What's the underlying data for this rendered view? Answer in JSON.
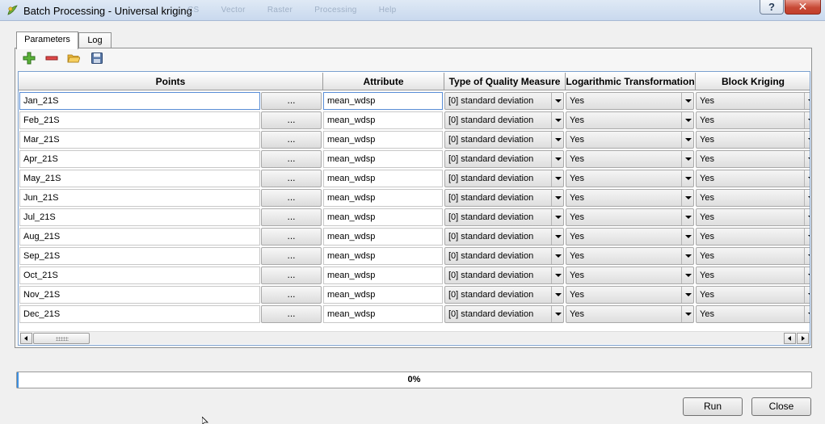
{
  "window": {
    "title": "Batch Processing - Universal kriging",
    "background_menu": [
      "CS",
      "Vector",
      "Raster",
      "Processing",
      "Help"
    ],
    "help_label": "?",
    "close_label": "✕"
  },
  "tabs": [
    {
      "label": "Parameters",
      "active": true
    },
    {
      "label": "Log",
      "active": false
    }
  ],
  "toolbar": {
    "icons": [
      "add-row-icon",
      "remove-row-icon",
      "open-folder-icon",
      "save-icon"
    ]
  },
  "table": {
    "columns": [
      "Points",
      "Attribute",
      "Type of Quality Measure",
      "Logarithmic Transformation",
      "Block Kriging"
    ],
    "browse_label": "...",
    "rows": [
      {
        "points": "Jan_21S",
        "attribute": "mean_wdsp",
        "quality_measure": "[0] standard deviation",
        "log_transform": "Yes",
        "block_kriging": "Yes"
      },
      {
        "points": "Feb_21S",
        "attribute": "mean_wdsp",
        "quality_measure": "[0] standard deviation",
        "log_transform": "Yes",
        "block_kriging": "Yes"
      },
      {
        "points": "Mar_21S",
        "attribute": "mean_wdsp",
        "quality_measure": "[0] standard deviation",
        "log_transform": "Yes",
        "block_kriging": "Yes"
      },
      {
        "points": "Apr_21S",
        "attribute": "mean_wdsp",
        "quality_measure": "[0] standard deviation",
        "log_transform": "Yes",
        "block_kriging": "Yes"
      },
      {
        "points": "May_21S",
        "attribute": "mean_wdsp",
        "quality_measure": "[0] standard deviation",
        "log_transform": "Yes",
        "block_kriging": "Yes"
      },
      {
        "points": "Jun_21S",
        "attribute": "mean_wdsp",
        "quality_measure": "[0] standard deviation",
        "log_transform": "Yes",
        "block_kriging": "Yes"
      },
      {
        "points": "Jul_21S",
        "attribute": "mean_wdsp",
        "quality_measure": "[0] standard deviation",
        "log_transform": "Yes",
        "block_kriging": "Yes"
      },
      {
        "points": "Aug_21S",
        "attribute": "mean_wdsp",
        "quality_measure": "[0] standard deviation",
        "log_transform": "Yes",
        "block_kriging": "Yes"
      },
      {
        "points": "Sep_21S",
        "attribute": "mean_wdsp",
        "quality_measure": "[0] standard deviation",
        "log_transform": "Yes",
        "block_kriging": "Yes"
      },
      {
        "points": "Oct_21S",
        "attribute": "mean_wdsp",
        "quality_measure": "[0] standard deviation",
        "log_transform": "Yes",
        "block_kriging": "Yes"
      },
      {
        "points": "Nov_21S",
        "attribute": "mean_wdsp",
        "quality_measure": "[0] standard deviation",
        "log_transform": "Yes",
        "block_kriging": "Yes"
      },
      {
        "points": "Dec_21S",
        "attribute": "mean_wdsp",
        "quality_measure": "[0] standard deviation",
        "log_transform": "Yes",
        "block_kriging": "Yes"
      }
    ]
  },
  "progress": {
    "value": 0,
    "label": "0%"
  },
  "buttons": {
    "run": "Run",
    "close": "Close"
  },
  "colors": {
    "progress_accent": "#3d8fe0",
    "table_focus": "#5a8ed6",
    "close_button": "#c74a36"
  }
}
